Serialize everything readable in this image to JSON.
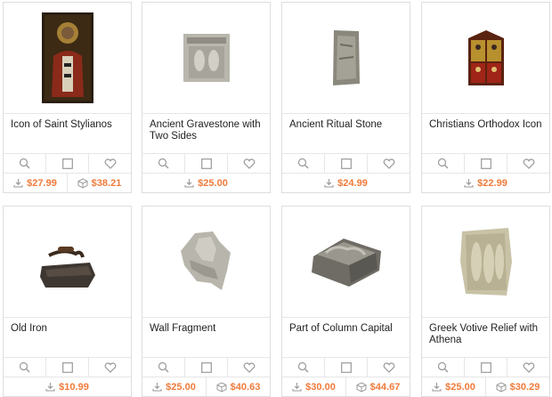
{
  "products": [
    {
      "title": "Icon of Saint Stylianos",
      "price_download": "$27.99",
      "price_print": "$38.21"
    },
    {
      "title": "Ancient Gravestone with Two Sides",
      "price_download": "$25.00",
      "price_print": ""
    },
    {
      "title": "Ancient Ritual Stone",
      "price_download": "$24.99",
      "price_print": ""
    },
    {
      "title": "Christians Orthodox Icon",
      "price_download": "$22.99",
      "price_print": ""
    },
    {
      "title": "Old Iron",
      "price_download": "$10.99",
      "price_print": ""
    },
    {
      "title": "Wall Fragment",
      "price_download": "$25.00",
      "price_print": "$40.63"
    },
    {
      "title": "Part of Column Capital",
      "price_download": "$30.00",
      "price_print": "$44.67"
    },
    {
      "title": "Greek Votive Relief with Athena",
      "price_download": "$25.00",
      "price_print": "$30.29"
    }
  ],
  "icons": {
    "zoom": "magnifier-icon",
    "compare": "checkbox-icon",
    "favorite": "heart-icon",
    "download": "download-icon",
    "print": "cube-icon"
  },
  "colors": {
    "price": "#f07a3a",
    "border": "#dedede",
    "icon": "#9a9a9a"
  }
}
